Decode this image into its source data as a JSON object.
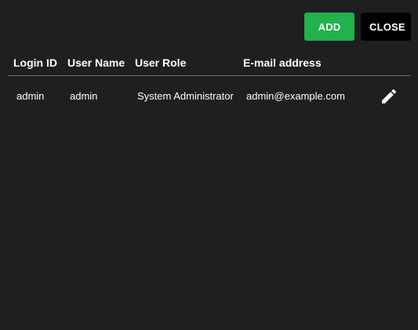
{
  "toolbar": {
    "add_label": "ADD",
    "close_label": "CLOSE"
  },
  "table": {
    "columns": [
      "Login ID",
      "User Name",
      "User Role",
      "E-mail address"
    ],
    "rows": [
      {
        "login_id": "admin",
        "user_name": "admin",
        "user_role": "System Administrator",
        "email": "admin@example.com",
        "action_icon": "edit-icon"
      }
    ]
  },
  "colors": {
    "background": "#1f1f1f",
    "add_button": "#22b14c",
    "close_button": "#000000",
    "divider": "#6b6b6b",
    "text": "#ffffff"
  }
}
